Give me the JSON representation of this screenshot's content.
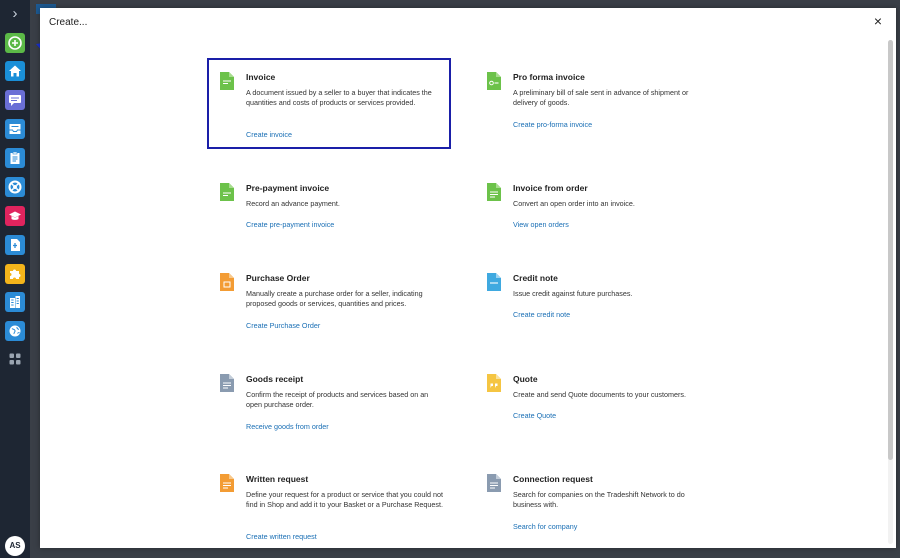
{
  "rail": {
    "items": [
      {
        "icon": "plus-icon",
        "color": "#5bb947"
      },
      {
        "icon": "home-icon",
        "color": "#1a8fd8"
      },
      {
        "icon": "chat-icon",
        "color": "#6a6fd6"
      },
      {
        "icon": "inbox-icon",
        "color": "#2b8bd6"
      },
      {
        "icon": "clipboard-icon",
        "color": "#2b8bd6"
      },
      {
        "icon": "lifebuoy-icon",
        "color": "#2b8bd6"
      },
      {
        "icon": "graduation-cap-icon",
        "color": "#e0245e"
      },
      {
        "icon": "document-icon",
        "color": "#2b8bd6"
      },
      {
        "icon": "puzzle-icon",
        "color": "#f3b41b"
      },
      {
        "icon": "building-icon",
        "color": "#2b8bd6"
      },
      {
        "icon": "globe-icon",
        "color": "#2b8bd6"
      },
      {
        "icon": "apps-grid-icon",
        "color": "#9aa4b0"
      }
    ],
    "avatar_initials": "AS"
  },
  "modal": {
    "title": "Create...",
    "close_label": "×"
  },
  "options": [
    {
      "key": "invoice",
      "title": "Invoice",
      "description": "A document issued by a seller to a buyer that indicates the quantities and costs of products or services provided.",
      "link": "Create invoice",
      "icon": "invoice-document-icon",
      "icon_color": "#6cc24a"
    },
    {
      "key": "proforma",
      "title": "Pro forma invoice",
      "description": "A preliminary bill of sale sent in advance of shipment or delivery of goods.",
      "link": "Create pro-forma invoice",
      "icon": "proforma-document-icon",
      "icon_color": "#6cc24a"
    },
    {
      "key": "prepayment",
      "title": "Pre-payment invoice",
      "description": "Record an advance payment.",
      "link": "Create pre-payment invoice",
      "icon": "prepayment-document-icon",
      "icon_color": "#6cc24a"
    },
    {
      "key": "from_order",
      "title": "Invoice from order",
      "description": "Convert an open order into an invoice.",
      "link": "View open orders",
      "icon": "order-invoice-document-icon",
      "icon_color": "#6cc24a"
    },
    {
      "key": "purchase_order",
      "title": "Purchase Order",
      "description": "Manually create a purchase order for a seller, indicating proposed goods or services, quantities and prices.",
      "link": "Create Purchase Order",
      "icon": "purchase-order-document-icon",
      "icon_color": "#f39c34"
    },
    {
      "key": "credit_note",
      "title": "Credit note",
      "description": "Issue credit against future purchases.",
      "link": "Create credit note",
      "icon": "credit-note-document-icon",
      "icon_color": "#3fa9e0"
    },
    {
      "key": "goods_receipt",
      "title": "Goods receipt",
      "description": "Confirm the receipt of products and services based on an open purchase order.",
      "link": "Receive goods from order",
      "icon": "goods-receipt-document-icon",
      "icon_color": "#8a9bb0"
    },
    {
      "key": "quote",
      "title": "Quote",
      "description": "Create and send Quote documents to your customers.",
      "link": "Create Quote",
      "icon": "quote-document-icon",
      "icon_color": "#f5c542"
    },
    {
      "key": "written_request",
      "title": "Written request",
      "description": "Define your request for a product or service that you could not find in Shop and add it to your Basket or a Purchase Request.",
      "link": "Create written request",
      "icon": "written-request-document-icon",
      "icon_color": "#f39c34"
    },
    {
      "key": "connection_request",
      "title": "Connection request",
      "description": "Search for companies on the Tradeshift Network to do business with.",
      "link": "Search for company",
      "icon": "connection-request-document-icon",
      "icon_color": "#8a9bb0"
    }
  ]
}
